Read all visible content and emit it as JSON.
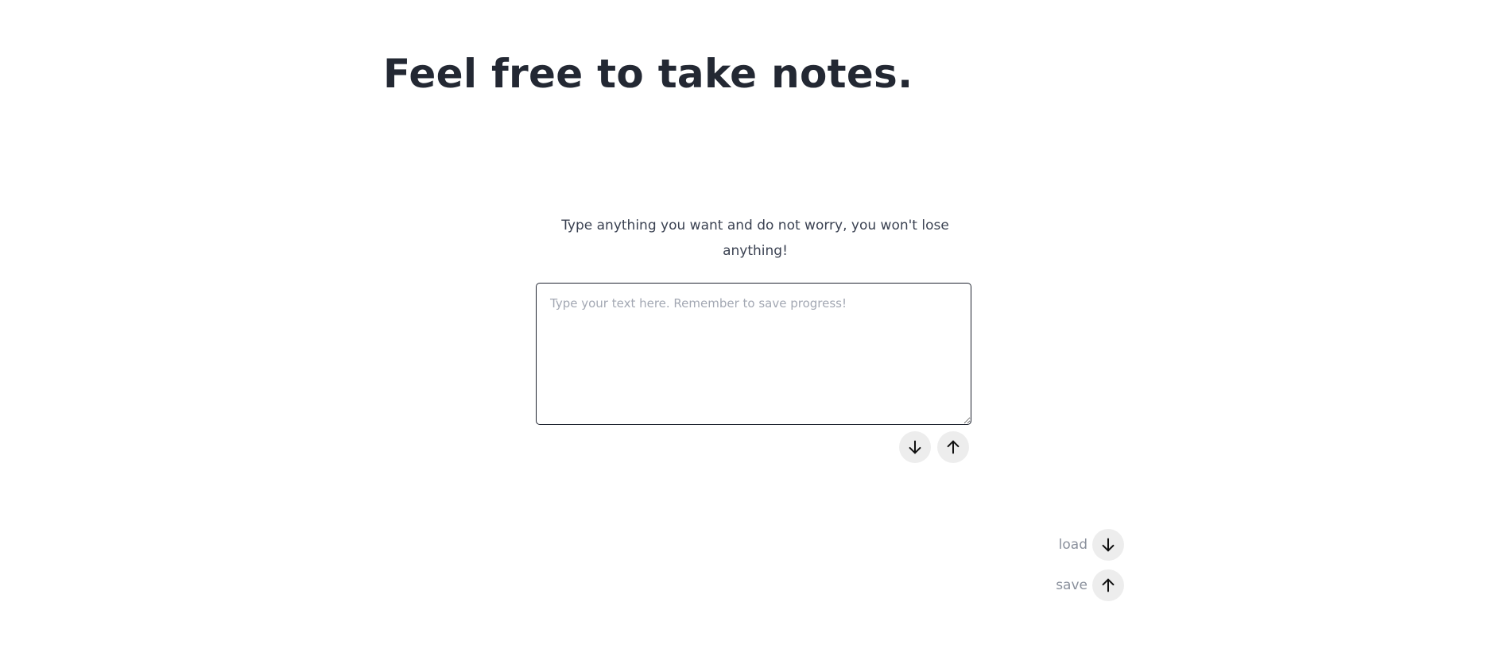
{
  "heading": "Feel free to take notes.",
  "intro": "Type anything you want and do not worry, you won't lose anything!",
  "notes_field": {
    "value": "",
    "placeholder": "Type your text here. Remember to save progress!"
  },
  "actions": {
    "load_label": "load",
    "save_label": "save"
  },
  "icons": {
    "load": "arrow-down-icon",
    "save": "arrow-up-icon"
  },
  "colors": {
    "heading": "#232833",
    "button_bg": "#ededed",
    "label_muted": "#8a909c",
    "textarea_border": "#1f2430"
  }
}
